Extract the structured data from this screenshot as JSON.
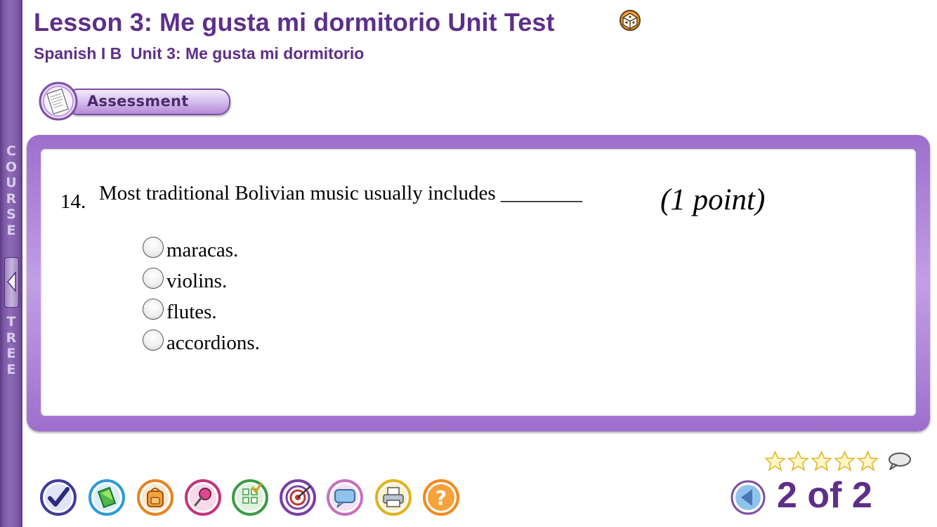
{
  "header": {
    "title": "Lesson 3: Me gusta mi dormitorio Unit Test",
    "subtitle": "Spanish I B  Unit 3: Me gusta mi dormitorio"
  },
  "sidebar": {
    "top_letters": "COURSE",
    "bottom_letters": "TREE",
    "icon": "collapse-arrow-icon"
  },
  "section_tab": {
    "label": "Assessment",
    "icon": "document-icon"
  },
  "question": {
    "number": "14.",
    "text": "Most traditional Bolivian music usually includes ________",
    "points": "(1 point)",
    "options": [
      "maracas.",
      "violins.",
      "flutes.",
      "accordions."
    ],
    "selected": null
  },
  "rating": {
    "stars_filled": 0,
    "stars_total": 5,
    "comment_icon": "speech-bubble-icon"
  },
  "toolbar": {
    "buttons": [
      {
        "name": "checkmark-icon",
        "color": "#3f3d99"
      },
      {
        "name": "book-icon",
        "color": "#2e9bd6"
      },
      {
        "name": "backpack-icon",
        "color": "#e8831e"
      },
      {
        "name": "pushpin-icon",
        "color": "#c4347a"
      },
      {
        "name": "checklist-icon",
        "color": "#3c9b45"
      },
      {
        "name": "target-icon",
        "color": "#7a3fa6"
      },
      {
        "name": "speech-bubble-icon",
        "color": "#c86fbf"
      },
      {
        "name": "printer-icon",
        "color": "#e0b31d"
      },
      {
        "name": "help-icon",
        "color": "#f08a1c"
      }
    ]
  },
  "pagination": {
    "current": 2,
    "total": 2,
    "label": "2 of 2",
    "prev_icon": "left-arrow-icon"
  },
  "colors": {
    "accent": "#5e2f8a",
    "frame": "#b48ad8"
  }
}
